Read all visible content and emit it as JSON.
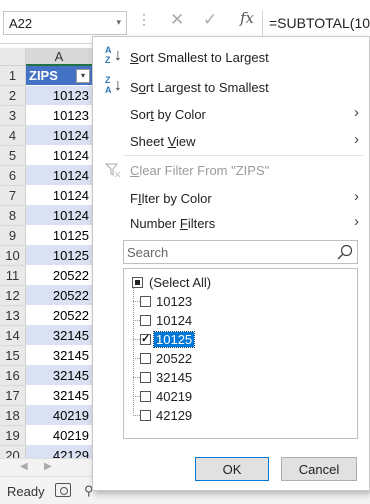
{
  "formula_bar": {
    "name_box": "A22",
    "name_box_arrow": "▾",
    "dots": "⋮",
    "cancel_icon": "✕",
    "enter_icon": "✓",
    "fx_icon": "fx",
    "formula": "=SUBTOTAL(10"
  },
  "grid": {
    "column_header": "A",
    "header_label": "ZIPS",
    "filter_glyph": "▾",
    "rows": [
      {
        "num": "1",
        "value": "ZIPS"
      },
      {
        "num": "2",
        "value": "10123"
      },
      {
        "num": "3",
        "value": "10123"
      },
      {
        "num": "4",
        "value": "10124"
      },
      {
        "num": "5",
        "value": "10124"
      },
      {
        "num": "6",
        "value": "10124"
      },
      {
        "num": "7",
        "value": "10124"
      },
      {
        "num": "8",
        "value": "10124"
      },
      {
        "num": "9",
        "value": "10125"
      },
      {
        "num": "10",
        "value": "10125"
      },
      {
        "num": "11",
        "value": "20522"
      },
      {
        "num": "12",
        "value": "20522"
      },
      {
        "num": "13",
        "value": "20522"
      },
      {
        "num": "14",
        "value": "32145"
      },
      {
        "num": "15",
        "value": "32145"
      },
      {
        "num": "16",
        "value": "32145"
      },
      {
        "num": "17",
        "value": "32145"
      },
      {
        "num": "18",
        "value": "40219"
      },
      {
        "num": "19",
        "value": "40219"
      },
      {
        "num": "20",
        "value": "42129"
      }
    ]
  },
  "sheet_nav": {
    "prev": "◀",
    "next": "▶"
  },
  "status": {
    "ready": "Ready",
    "icon2": "⚲"
  },
  "menu": {
    "sort_asc": {
      "prefix": "",
      "u": "S",
      "rest": "ort Smallest to Largest"
    },
    "sort_desc": {
      "prefix": "S",
      "u": "o",
      "rest": "rt Largest to Smallest"
    },
    "sort_by_color": {
      "prefix": "Sor",
      "u": "t",
      "rest": " by Color"
    },
    "sheet_view": {
      "prefix": "Sheet ",
      "u": "V",
      "rest": "iew"
    },
    "clear_filter": {
      "prefix": "",
      "u": "C",
      "rest": "lear Filter From \"ZIPS\""
    },
    "filter_by_color": {
      "prefix": "",
      "u": "I",
      "rest": "lter by Color",
      "display_prefix": "F"
    },
    "number_filters": {
      "prefix": "",
      "u": "F",
      "rest": "ilters",
      "display_prefix": "Number "
    },
    "chevron": "›",
    "sort_letter_a": "A",
    "sort_letter_z": "Z",
    "sort_arrow": "↓",
    "search_placeholder": "Search",
    "items": [
      {
        "label": "(Select All)",
        "state": "partial"
      },
      {
        "label": "10123",
        "state": "unchecked"
      },
      {
        "label": "10124",
        "state": "unchecked"
      },
      {
        "label": "10125",
        "state": "checked"
      },
      {
        "label": "20522",
        "state": "unchecked"
      },
      {
        "label": "32145",
        "state": "unchecked"
      },
      {
        "label": "40219",
        "state": "unchecked"
      },
      {
        "label": "42129",
        "state": "unchecked"
      }
    ],
    "ok_label": "OK",
    "cancel_label": "Cancel"
  },
  "colors": {
    "header_fill": "#4472c4",
    "band_fill": "#d9e1f2",
    "selection": "#0078d7",
    "sort_icon": "#2e75b6"
  }
}
